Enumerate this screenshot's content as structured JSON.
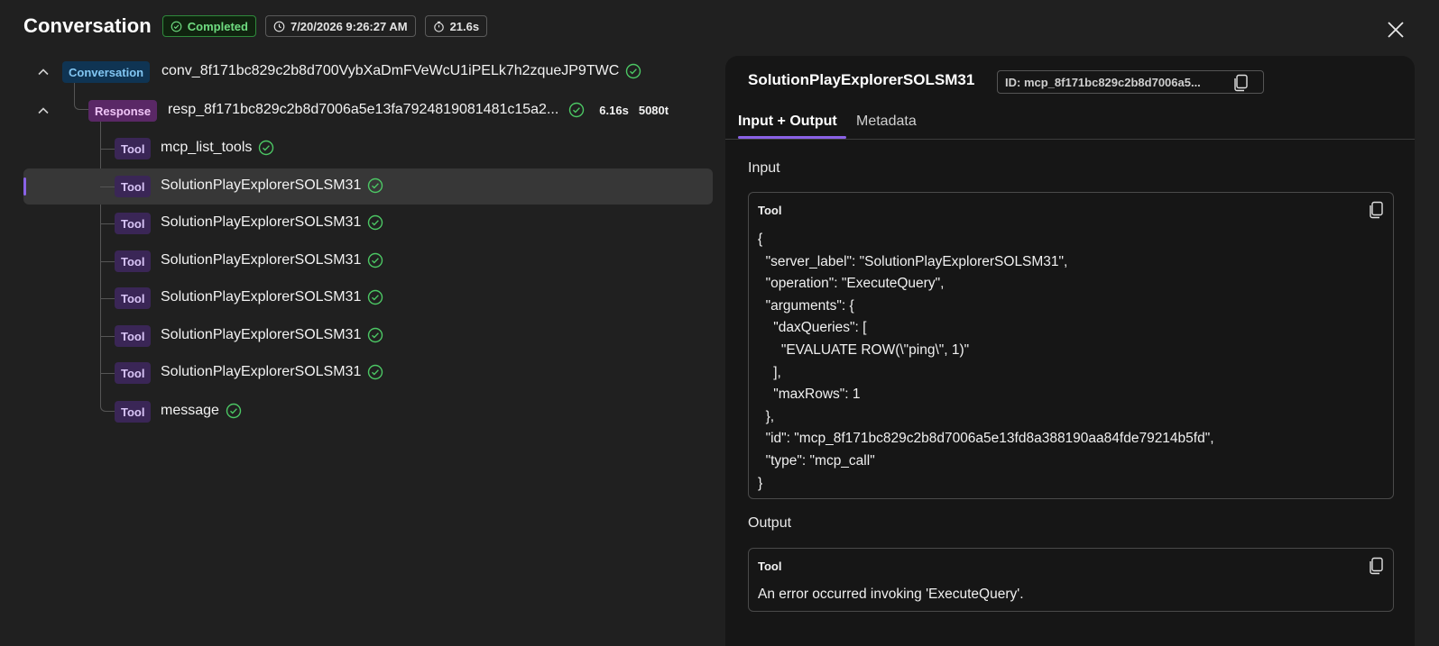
{
  "header": {
    "title": "Conversation",
    "status": "Completed",
    "timestamp": "7/20/2026 9:26:27 AM",
    "duration": "21.6s"
  },
  "tree": {
    "conversation": {
      "badge": "Conversation",
      "label": "conv_8f171bc829c2b8d700VybXaDmFVeWcU1iPELk7h2zqueJP9TWC"
    },
    "response": {
      "badge": "Response",
      "label": "resp_8f171bc829c2b8d7006a5e13fa7924819081481c15a2...",
      "time": "6.16s",
      "tokens": "5080t"
    },
    "tools": [
      {
        "badge": "Tool",
        "label": "mcp_list_tools"
      },
      {
        "badge": "Tool",
        "label": "SolutionPlayExplorerSOLSM31"
      },
      {
        "badge": "Tool",
        "label": "SolutionPlayExplorerSOLSM31"
      },
      {
        "badge": "Tool",
        "label": "SolutionPlayExplorerSOLSM31"
      },
      {
        "badge": "Tool",
        "label": "SolutionPlayExplorerSOLSM31"
      },
      {
        "badge": "Tool",
        "label": "SolutionPlayExplorerSOLSM31"
      },
      {
        "badge": "Tool",
        "label": "SolutionPlayExplorerSOLSM31"
      },
      {
        "badge": "Tool",
        "label": "message"
      }
    ]
  },
  "panel": {
    "title": "SolutionPlayExplorerSOLSM31",
    "id_text": "ID: mcp_8f171bc829c2b8d7006a5...",
    "tabs": [
      "Input + Output",
      "Metadata"
    ],
    "input_label": "Input",
    "input_box_title": "Tool",
    "input_code": "{\n  \"server_label\": \"SolutionPlayExplorerSOLSM31\",\n  \"operation\": \"ExecuteQuery\",\n  \"arguments\": {\n    \"daxQueries\": [\n      \"EVALUATE ROW(\\\"ping\\\", 1)\"\n    ],\n    \"maxRows\": 1\n  },\n  \"id\": \"mcp_8f171bc829c2b8d7006a5e13fd8a388190aa84fde79214b5fd\",\n  \"type\": \"mcp_call\"\n}",
    "output_label": "Output",
    "output_box_title": "Tool",
    "output_text": "An error occurred invoking 'ExecuteQuery'."
  },
  "colors": {
    "accent": "#8a62e6",
    "success": "#4cc764",
    "background": "#202020",
    "panel": "#161616"
  }
}
